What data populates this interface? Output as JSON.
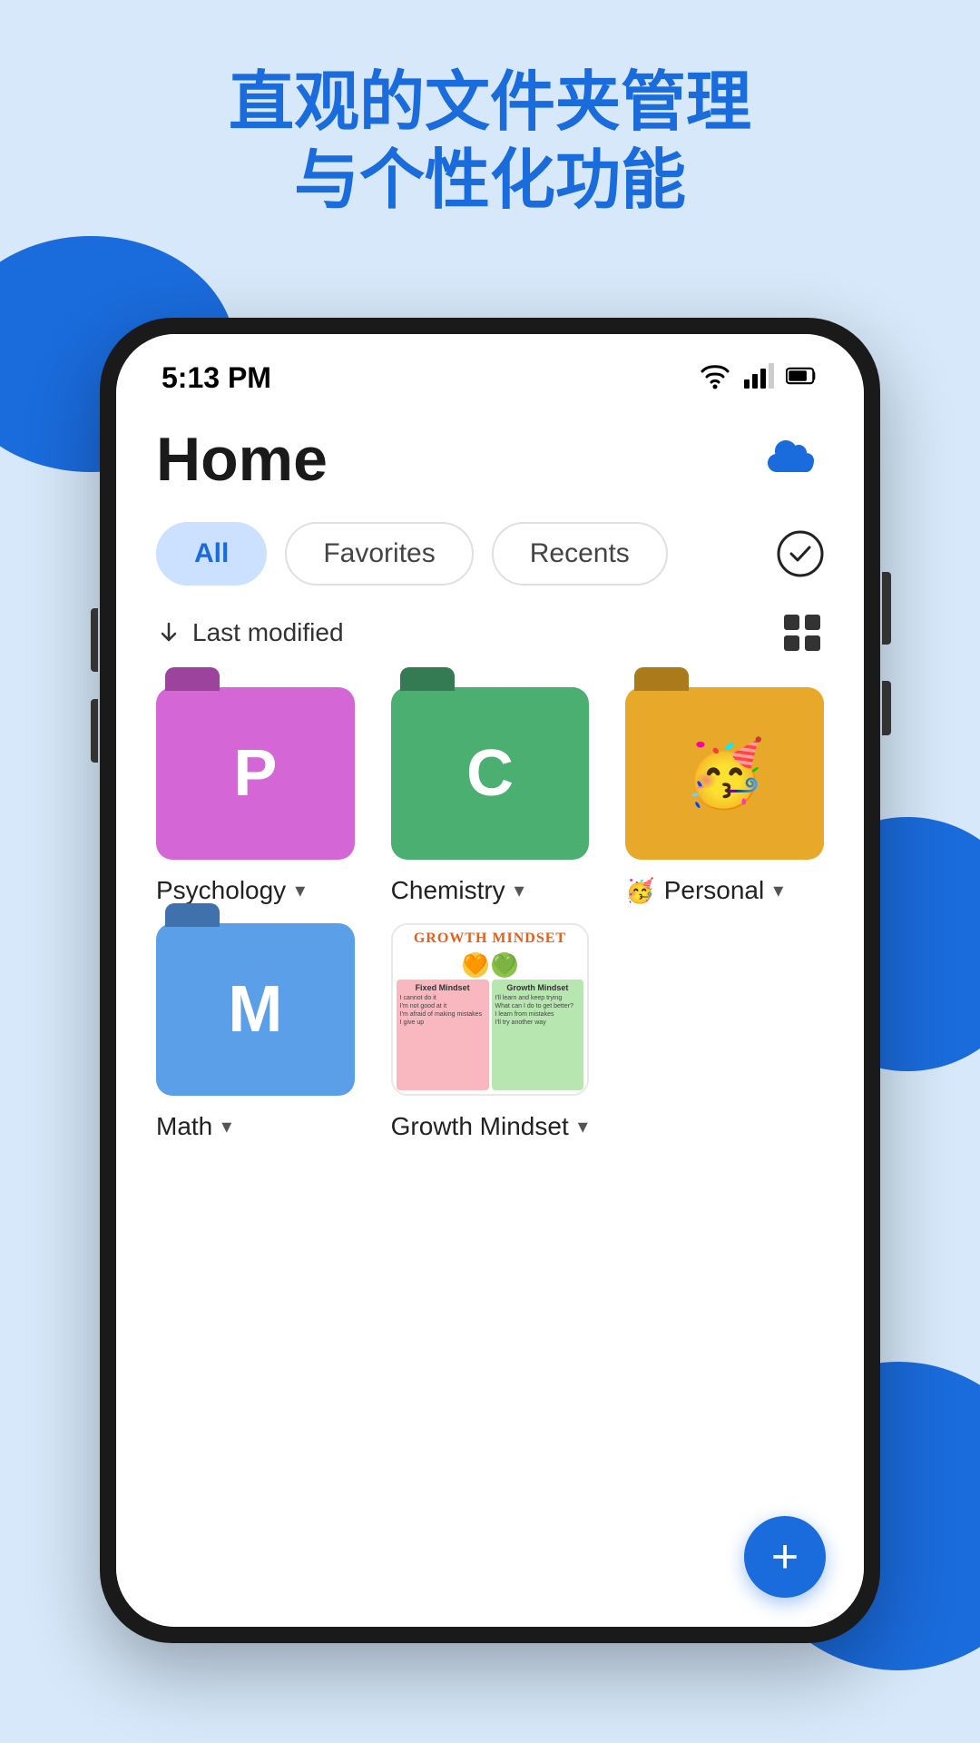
{
  "hero": {
    "title_line1": "直观的文件夹管理",
    "title_line2": "与个性化功能"
  },
  "status_bar": {
    "time": "5:13 PM"
  },
  "app": {
    "title": "Home",
    "tabs": [
      {
        "label": "All",
        "active": true
      },
      {
        "label": "Favorites",
        "active": false
      },
      {
        "label": "Recents",
        "active": false
      }
    ],
    "sort_label": "Last modified",
    "folders": [
      {
        "id": "psychology",
        "name": "Psychology",
        "type": "letter",
        "letter": "P",
        "color_class": "folder-purple",
        "emoji": null
      },
      {
        "id": "chemistry",
        "name": "Chemistry",
        "type": "letter",
        "letter": "C",
        "color_class": "folder-green",
        "emoji": null
      },
      {
        "id": "personal",
        "name": "Personal",
        "type": "letter",
        "letter": "🥳",
        "color_class": "folder-yellow",
        "emoji": "🥳"
      },
      {
        "id": "math",
        "name": "Math",
        "type": "letter",
        "letter": "M",
        "color_class": "folder-blue",
        "emoji": null
      },
      {
        "id": "growth-mindset",
        "name": "Growth Mindset",
        "type": "thumbnail",
        "letter": null,
        "color_class": null,
        "emoji": null
      }
    ],
    "fab_label": "+"
  }
}
